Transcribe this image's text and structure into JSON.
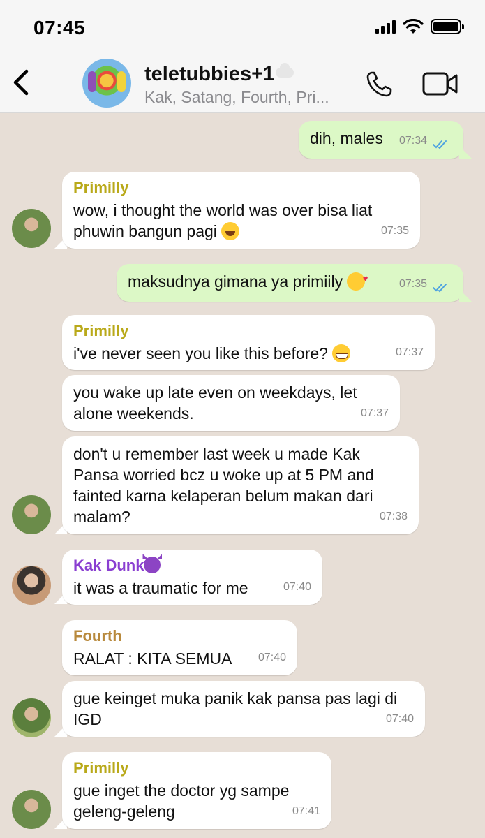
{
  "status_bar": {
    "time": "07:45"
  },
  "header": {
    "title": "teletubbies+1",
    "members": "Kak, Satang, Fourth, Pri..."
  },
  "messages": [
    {
      "dir": "out",
      "text": "dih, males",
      "time": "07:34"
    },
    {
      "dir": "in",
      "sender": "Primilly",
      "sender_color": "#b9a91a",
      "text": "wow, i thought the world was over bisa liat phuwin bangun pagi",
      "emoji": "face-with-tears-of-joy",
      "time": "07:35"
    },
    {
      "dir": "out",
      "text": "maksudnya gimana ya primiily",
      "emoji": "smiling-face-with-hearts",
      "time": "07:35"
    },
    {
      "dir": "in",
      "sender": "Primilly",
      "sender_color": "#b9a91a",
      "text": "i've never seen you like this before?",
      "emoji": "grinning-face",
      "time": "07:37"
    },
    {
      "dir": "in",
      "text": "you wake up late even on weekdays, let alone weekends.",
      "time": "07:37"
    },
    {
      "dir": "in",
      "text": "don't u remember last week u made Kak Pansa worried bcz u woke up at 5 PM and fainted karna kelaperan belum makan dari malam?",
      "time": "07:38"
    },
    {
      "dir": "in",
      "sender": "Kak Dunk",
      "sender_emoji": "smiling-face-with-horns",
      "sender_color": "#8a3fd1",
      "text": "it was a traumatic for me",
      "time": "07:40"
    },
    {
      "dir": "in",
      "sender": "Fourth",
      "sender_color": "#b8893c",
      "text": "RALAT : KITA SEMUA",
      "time": "07:40"
    },
    {
      "dir": "in",
      "text": "gue keinget muka panik kak pansa pas lagi di IGD",
      "time": "07:40"
    },
    {
      "dir": "in",
      "sender": "Primilly",
      "sender_color": "#b9a91a",
      "text": "gue inget the doctor yg sampe geleng-geleng",
      "time": "07:41"
    }
  ],
  "colors": {
    "outgoing_bubble": "#dcf8c6",
    "incoming_bubble": "#ffffff",
    "chat_background": "#e7ded6",
    "read_ticks": "#4fa3e0",
    "header_icons": "#111111"
  }
}
